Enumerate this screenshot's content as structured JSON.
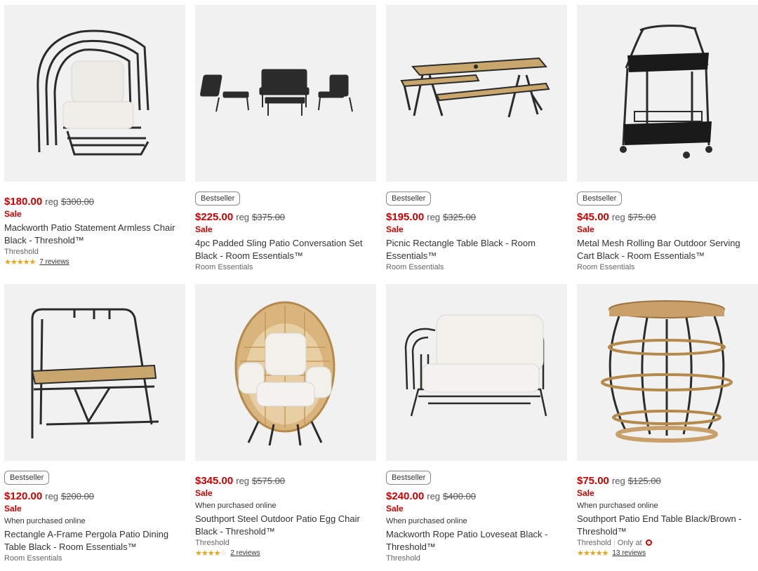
{
  "colors": {
    "sale_red": "#cc0000",
    "star": "#e8a317",
    "image_bg": "#f1f1f1"
  },
  "products": [
    {
      "badge": "",
      "price": "$180.00",
      "reg_label": "reg",
      "reg_price": "$300.00",
      "sale": "Sale",
      "note": "",
      "title_line1": "Mackworth Patio Statement Armless Chair",
      "title_line2": "Black - Threshold™",
      "brand": "Threshold",
      "only_at": "",
      "rating": 5,
      "reviews": "7 reviews",
      "image_icon": "statement-chair"
    },
    {
      "badge": "Bestseller",
      "price": "$225.00",
      "reg_label": "reg",
      "reg_price": "$375.00",
      "sale": "Sale",
      "note": "",
      "title_line1": "4pc Padded Sling Patio Conversation Set",
      "title_line2": "Black - Room Essentials™",
      "brand": "Room Essentials",
      "only_at": "",
      "rating": 0,
      "reviews": "",
      "image_icon": "conversation-set"
    },
    {
      "badge": "Bestseller",
      "price": "$195.00",
      "reg_label": "reg",
      "reg_price": "$325.00",
      "sale": "Sale",
      "note": "",
      "title_line1": "Picnic Rectangle Table Black - Room",
      "title_line2": "Essentials™",
      "brand": "Room Essentials",
      "only_at": "",
      "rating": 0,
      "reviews": "",
      "image_icon": "picnic-table"
    },
    {
      "badge": "Bestseller",
      "price": "$45.00",
      "reg_label": "reg",
      "reg_price": "$75.00",
      "sale": "Sale",
      "note": "",
      "title_line1": "Metal Mesh Rolling Bar Outdoor Serving",
      "title_line2": "Cart Black - Room Essentials™",
      "brand": "Room Essentials",
      "only_at": "",
      "rating": 0,
      "reviews": "",
      "image_icon": "bar-cart"
    },
    {
      "badge": "Bestseller",
      "price": "$120.00",
      "reg_label": "reg",
      "reg_price": "$200.00",
      "sale": "Sale",
      "note": "When purchased online",
      "title_line1": "Rectangle A-Frame Pergola Patio Dining",
      "title_line2": "Table Black - Room Essentials™",
      "brand": "Room Essentials",
      "only_at": "",
      "rating": 0,
      "reviews": "",
      "image_icon": "pergola-table"
    },
    {
      "badge": "",
      "price": "$345.00",
      "reg_label": "reg",
      "reg_price": "$575.00",
      "sale": "Sale",
      "note": "When purchased online",
      "title_line1": "Southport Steel Outdoor Patio Egg Chair",
      "title_line2": "Black - Threshold™",
      "brand": "Threshold",
      "only_at": "",
      "rating": 4,
      "reviews": "2 reviews",
      "image_icon": "egg-chair"
    },
    {
      "badge": "Bestseller",
      "price": "$240.00",
      "reg_label": "reg",
      "reg_price": "$400.00",
      "sale": "Sale",
      "note": "When purchased online",
      "title_line1": "Mackworth Rope Patio Loveseat Black -",
      "title_line2": "Threshold™",
      "brand": "Threshold",
      "only_at": "",
      "rating": 0,
      "reviews": "",
      "image_icon": "loveseat"
    },
    {
      "badge": "",
      "price": "$75.00",
      "reg_label": "reg",
      "reg_price": "$125.00",
      "sale": "Sale",
      "note": "When purchased online",
      "title_line1": "Southport Patio End Table Black/Brown -",
      "title_line2": "Threshold™",
      "brand": "Threshold",
      "only_at": "Only at",
      "rating": 5,
      "reviews": "13 reviews",
      "image_icon": "end-table"
    }
  ]
}
